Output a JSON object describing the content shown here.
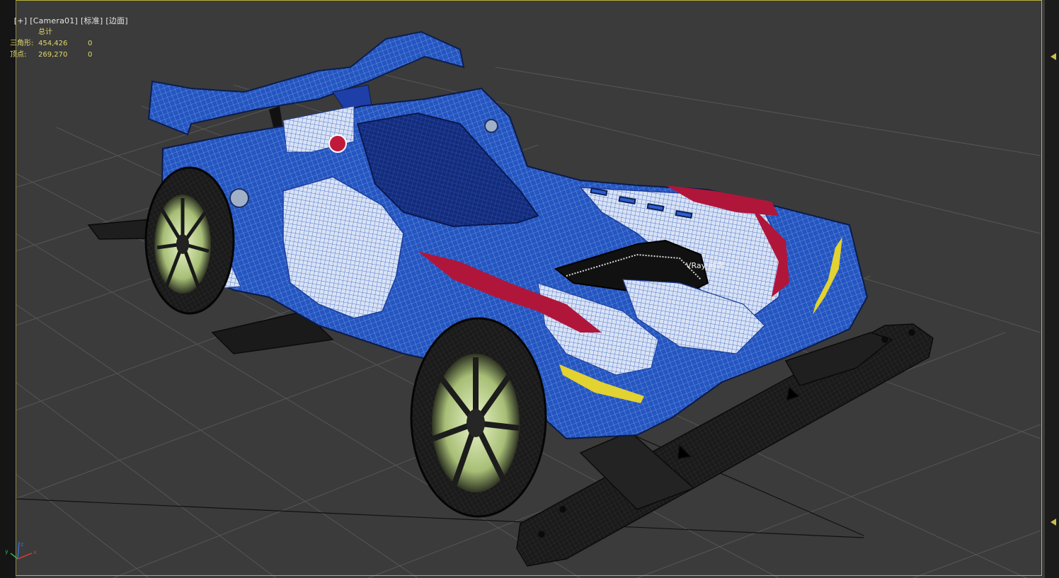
{
  "viewport": {
    "menu": {
      "plus": "[+]",
      "camera": "[Camera01]",
      "shading": "[标准]",
      "edges": "[边面]"
    },
    "stats": {
      "header": "总计",
      "rows": [
        {
          "label": "三角形:",
          "total": "454,426",
          "selected": "0"
        },
        {
          "label": "顶点:",
          "total": "269,270",
          "selected": "0"
        }
      ]
    },
    "object_label": "VRay 地坪"
  },
  "colors": {
    "frame_border": "#b8b23a",
    "stats_text": "#e1d86a",
    "car_body": "#1d4fb8",
    "grid_line": "#5a5a5a"
  },
  "icons": {
    "collapse_arrow_top": "triangle-left-icon",
    "collapse_arrow_bottom": "triangle-left-icon",
    "axis_gizmo": "xyz-axis-icon"
  }
}
